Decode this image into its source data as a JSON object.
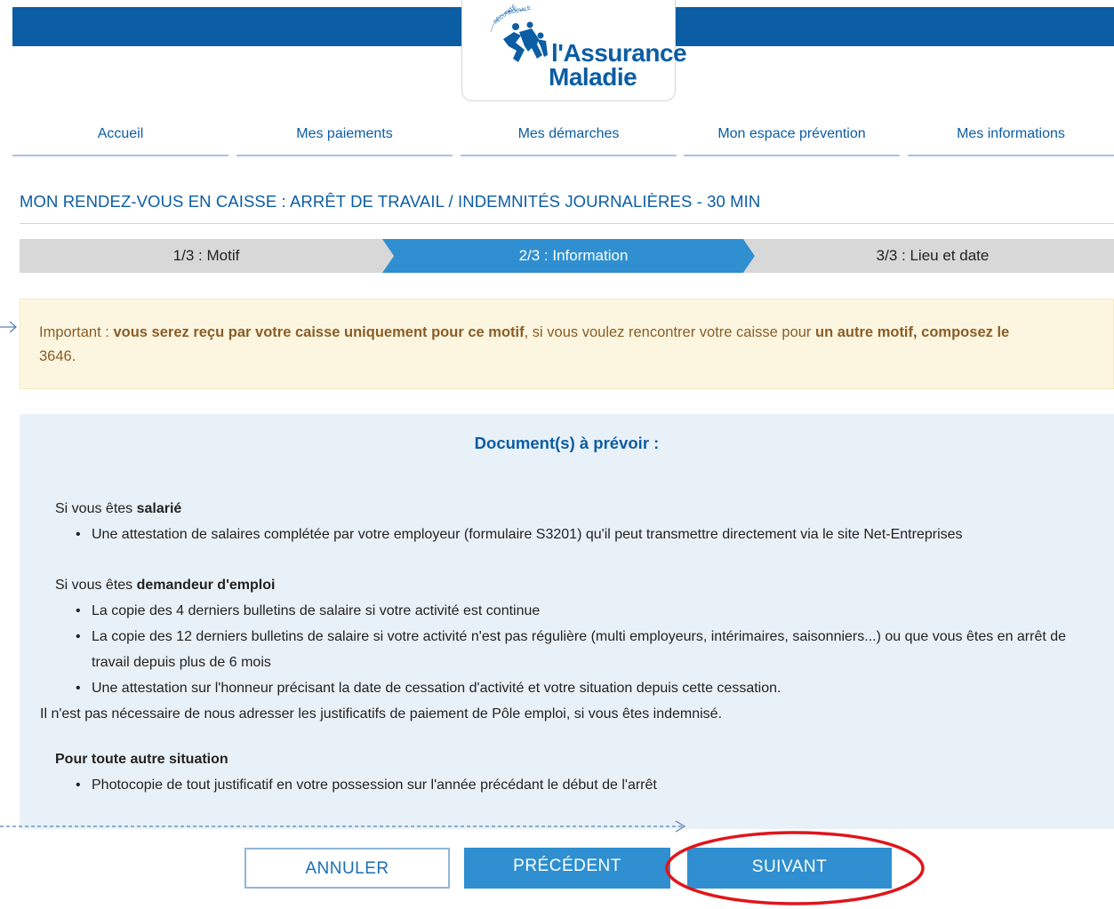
{
  "header": {
    "logo_line1": "l'Assurance",
    "logo_line2": "Maladie",
    "logo_seal_text": "SÉCURITÉ SOCIALE"
  },
  "nav": {
    "items": [
      {
        "label": "Accueil"
      },
      {
        "label": "Mes paiements"
      },
      {
        "label": "Mes démarches"
      },
      {
        "label": "Mon espace prévention"
      },
      {
        "label": "Mes informations"
      }
    ]
  },
  "page": {
    "title": "MON RENDEZ-VOUS EN CAISSE : ARRÊT DE TRAVAIL / INDEMNITÉS JOURNALIÈRES - 30 MIN"
  },
  "steps": [
    {
      "label": "1/3 : Motif",
      "state": "done"
    },
    {
      "label": "2/3 : Information",
      "state": "active"
    },
    {
      "label": "3/3 : Lieu et date",
      "state": "todo"
    }
  ],
  "alert": {
    "prefix": "Important : ",
    "bold1": "vous serez reçu par votre caisse uniquement pour ce motif",
    "middle": ", si vous voulez rencontrer votre caisse pour ",
    "bold2": "un autre motif, composez le",
    "suffix": "3646."
  },
  "documents": {
    "title": "Document(s) à prévoir :",
    "salarie": {
      "intro": "Si vous êtes ",
      "bold": "salarié",
      "items": [
        "Une attestation de salaires complétée par votre employeur (formulaire S3201) qu'il peut transmettre directement via le site Net-Entreprises"
      ]
    },
    "demandeur": {
      "intro": "Si vous êtes ",
      "bold": "demandeur d'emploi",
      "items": [
        "La copie des 4 derniers bulletins de salaire si votre activité est continue",
        "La copie des 12 derniers bulletins de salaire si votre activité n'est pas régulière (multi employeurs, intérimaires, saisonniers...) ou que vous êtes en arrêt de travail depuis plus de 6 mois",
        "Une attestation sur l'honneur précisant la date de cessation d'activité et votre situation depuis cette cessation."
      ],
      "note": "Il n'est pas nécessaire de nous adresser les justificatifs de paiement de Pôle emploi, si vous êtes indemnisé."
    },
    "autre": {
      "bold": "Pour toute autre situation",
      "items": [
        "Photocopie de tout justificatif en votre possession sur l'année précédant le début de l'arrêt"
      ]
    }
  },
  "buttons": {
    "cancel": "ANNULER",
    "previous": "PRÉCÉDENT",
    "next": "SUIVANT"
  },
  "colors": {
    "brand_blue": "#0b5da4",
    "step_active": "#2f8fd0",
    "step_inactive": "#d8d8d8",
    "alert_bg": "#fcf6e1",
    "panel_bg": "#e9f1f8",
    "annotation_red": "#e0151b"
  },
  "icons": {
    "alert_pointer": "arrow-right-icon",
    "logo": "assurance-maladie-logo"
  }
}
